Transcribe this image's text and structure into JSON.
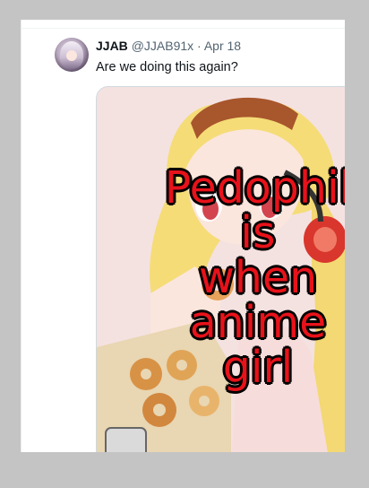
{
  "tweet": {
    "display_name": "JJAB",
    "handle": "@JJAB91x",
    "separator": "·",
    "date": "Apr 18",
    "text": "Are we doing this again?"
  },
  "media": {
    "caption_lines": [
      "Pedophil",
      "is",
      "when",
      "anime",
      "girl"
    ],
    "colors": {
      "caption": "#e8121a",
      "caption_outline": "#000000"
    }
  },
  "colors": {
    "background": "#c4c4c4",
    "panel": "#ffffff",
    "primary_text": "#0f1419",
    "secondary_text": "#536471",
    "media_border": "#cfd9de"
  }
}
